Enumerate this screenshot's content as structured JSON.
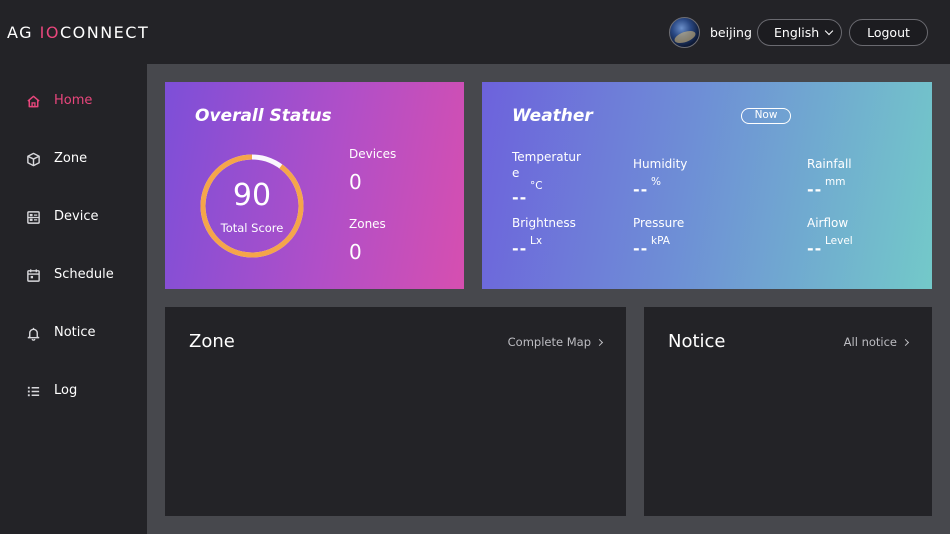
{
  "header": {
    "logo_part1": "AG ",
    "logo_accent": "IO",
    "logo_part2": "CONNECT",
    "user_name": "beijing",
    "language": "English",
    "logout_label": "Logout"
  },
  "sidebar": {
    "items": [
      {
        "label": "Home",
        "icon": "home-icon",
        "active": true
      },
      {
        "label": "Zone",
        "icon": "cube-icon"
      },
      {
        "label": "Device",
        "icon": "device-icon"
      },
      {
        "label": "Schedule",
        "icon": "calendar-icon"
      },
      {
        "label": "Notice",
        "icon": "bell-icon"
      },
      {
        "label": "Log",
        "icon": "list-icon"
      }
    ]
  },
  "overall_status": {
    "title": "Overall Status",
    "score": "90",
    "score_fraction": 0.9,
    "score_label": "Total Score",
    "devices_label": "Devices",
    "devices_value": "0",
    "zones_label": "Zones",
    "zones_value": "0"
  },
  "weather": {
    "title": "Weather",
    "badge": "Now",
    "temperature": {
      "label_line1": "Temperatur",
      "label_line2": "e",
      "value": "--",
      "unit": "°C"
    },
    "humidity": {
      "label": "Humidity",
      "value": "--",
      "unit": "%"
    },
    "rainfall": {
      "label": "Rainfall",
      "value": "--",
      "unit": "mm"
    },
    "brightness": {
      "label": "Brightness",
      "value": "--",
      "unit": "Lx"
    },
    "pressure": {
      "label": "Pressure",
      "value": "--",
      "unit": "kPA"
    },
    "airflow": {
      "label": "Airflow",
      "value": "--",
      "unit": "Level"
    }
  },
  "zone_panel": {
    "title": "Zone",
    "link_label": "Complete Map"
  },
  "notice_panel": {
    "title": "Notice",
    "link_label": "All notice"
  },
  "colors": {
    "accent": "#e8467c",
    "gauge_orange": "#f5a54a",
    "gauge_track": "#ffffff",
    "panel_bg": "#232327",
    "page_bg": "#47484d"
  }
}
